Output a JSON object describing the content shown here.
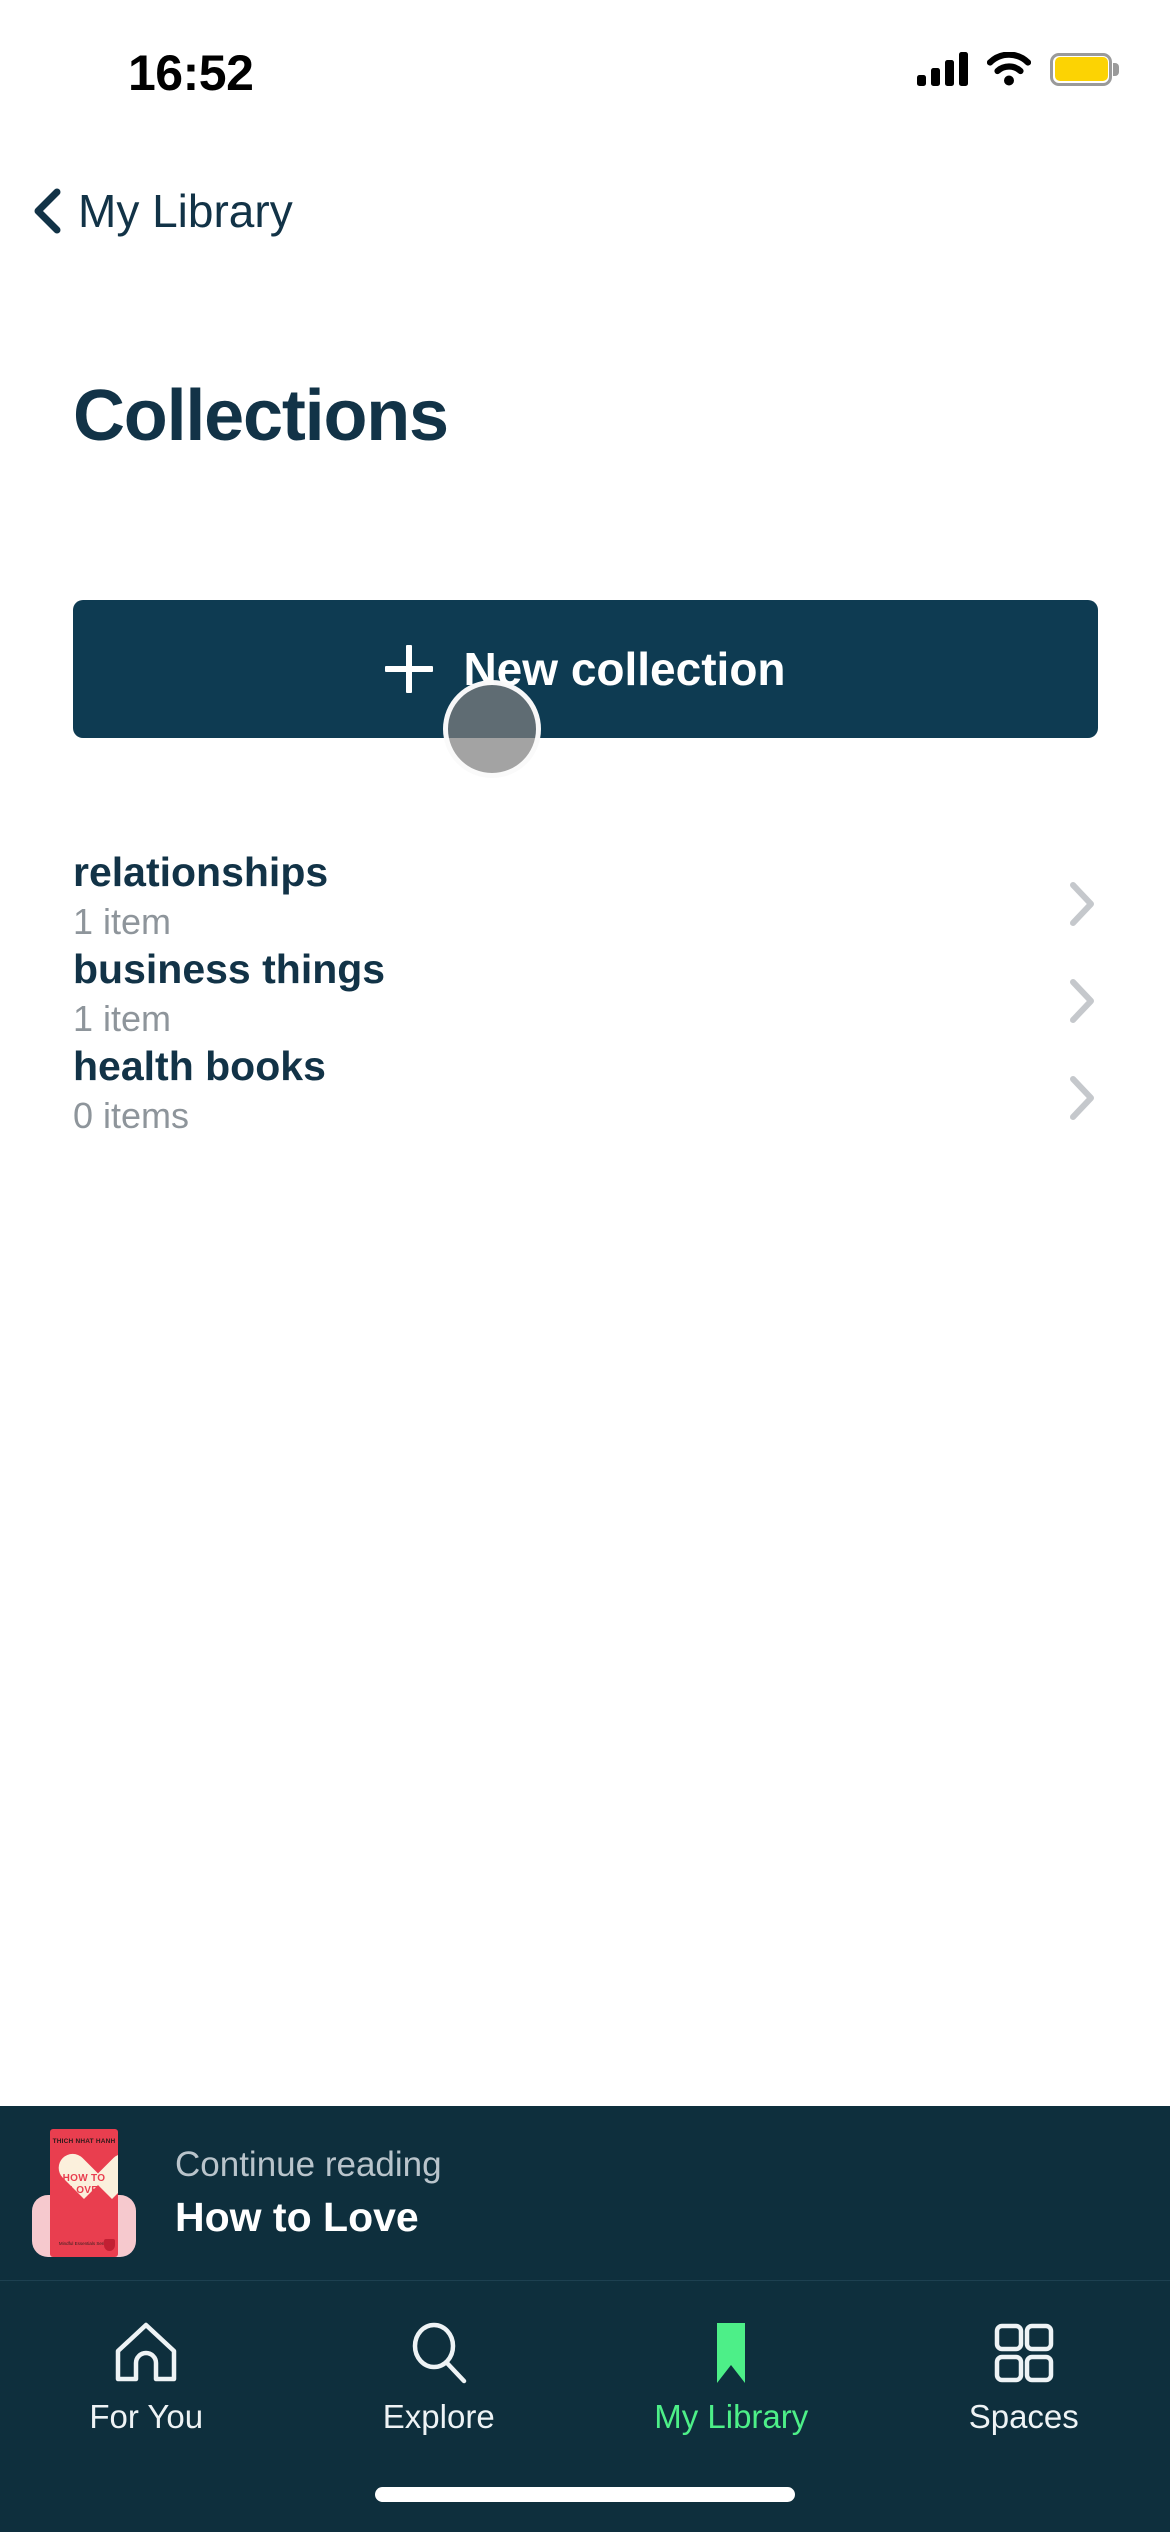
{
  "status_bar": {
    "time": "16:52",
    "signal_icon": "cellular-signal-icon",
    "wifi_icon": "wifi-icon",
    "battery_icon": "battery-icon",
    "battery_color": "#FCD303"
  },
  "nav": {
    "back_icon": "chevron-left-icon",
    "back_label": "My Library"
  },
  "page": {
    "title": "Collections"
  },
  "new_collection": {
    "icon": "plus-icon",
    "label": "New collection",
    "background": "#0E3B52"
  },
  "touch_indicator": {
    "name": "touch-point-indicator"
  },
  "collections": [
    {
      "name": "relationships",
      "count": "1 item",
      "chevron": "chevron-right-icon"
    },
    {
      "name": "business things",
      "count": "1 item",
      "chevron": "chevron-right-icon"
    },
    {
      "name": "health books",
      "count": "0 items",
      "chevron": "chevron-right-icon"
    }
  ],
  "continue_reading": {
    "label": "Continue reading",
    "title": "How to Love",
    "cover": {
      "author": "THICH NHAT HANH",
      "title_line1": "HOW TO",
      "title_line2": "LOVE",
      "subtitle": "Mindful Essentials Series",
      "color": "#E93E4F",
      "heart_color": "#FBF0DC"
    },
    "background": "#0E2F3D"
  },
  "tab_bar": {
    "background": "#0E2F3D",
    "active_color": "#4DEF88",
    "inactive_color": "#EEF3F5",
    "items": [
      {
        "label": "For You",
        "icon": "home-icon",
        "active": false
      },
      {
        "label": "Explore",
        "icon": "search-icon",
        "active": false
      },
      {
        "label": "My Library",
        "icon": "bookmark-icon",
        "active": true
      },
      {
        "label": "Spaces",
        "icon": "grid-icon",
        "active": false
      }
    ]
  },
  "colors": {
    "navy": "#123347",
    "button_navy": "#0E3B52",
    "bar_navy": "#0E2F3D",
    "accent_green": "#4DEF88",
    "muted_gray": "#8E959B",
    "chevron_gray": "#C5C8CC"
  }
}
